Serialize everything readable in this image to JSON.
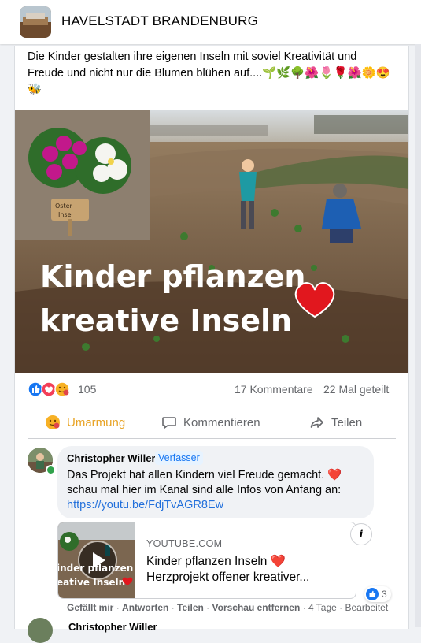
{
  "header": {
    "page_name": "HAVELSTADT BRANDENBURG"
  },
  "post": {
    "text": "Die Kinder gestalten ihre eigenen Inseln mit soviel Kreativität und Freude und nicht nur die Blumen blühen auf....🌱🌿🌳🌺🌷🌹🌺🌼😍🐝",
    "image": {
      "sign_text": "Oster Insel",
      "title_line1": "Kinder pflanzen",
      "title_line2": "kreative Inseln"
    },
    "stats": {
      "reaction_count": "105",
      "comments": "17 Kommentare",
      "shares": "22 Mal geteilt"
    },
    "actions": {
      "react": "Umarmung",
      "comment": "Kommentieren",
      "share": "Teilen"
    }
  },
  "comment": {
    "author": "Christopher Willer",
    "badge": "Verfasser",
    "text": "Das Projekt hat allen Kindern viel Freude gemacht. ❤️ schau mal hier im Kanal sind alle Infos von Anfang an:",
    "link": "https://youtu.be/FdjTvAGR8Ew",
    "preview": {
      "domain": "YOUTUBE.COM",
      "title": "Kinder pflanzen Inseln ❤️ Herzprojekt offener kreativer...",
      "thumb_text_line1": "inder pflanzen",
      "thumb_text_line2": "eative Inseln"
    },
    "like_count": "3",
    "actions": {
      "like": "Gefällt mir",
      "reply": "Antworten",
      "share": "Teilen",
      "remove_preview": "Vorschau entfernen",
      "age": "4 Tage",
      "edited": "Bearbeitet"
    }
  },
  "next_comment": {
    "author": "Christopher Willer"
  },
  "colors": {
    "accent": "#1877f2",
    "hug": "#e8a324",
    "muted": "#65676b"
  }
}
